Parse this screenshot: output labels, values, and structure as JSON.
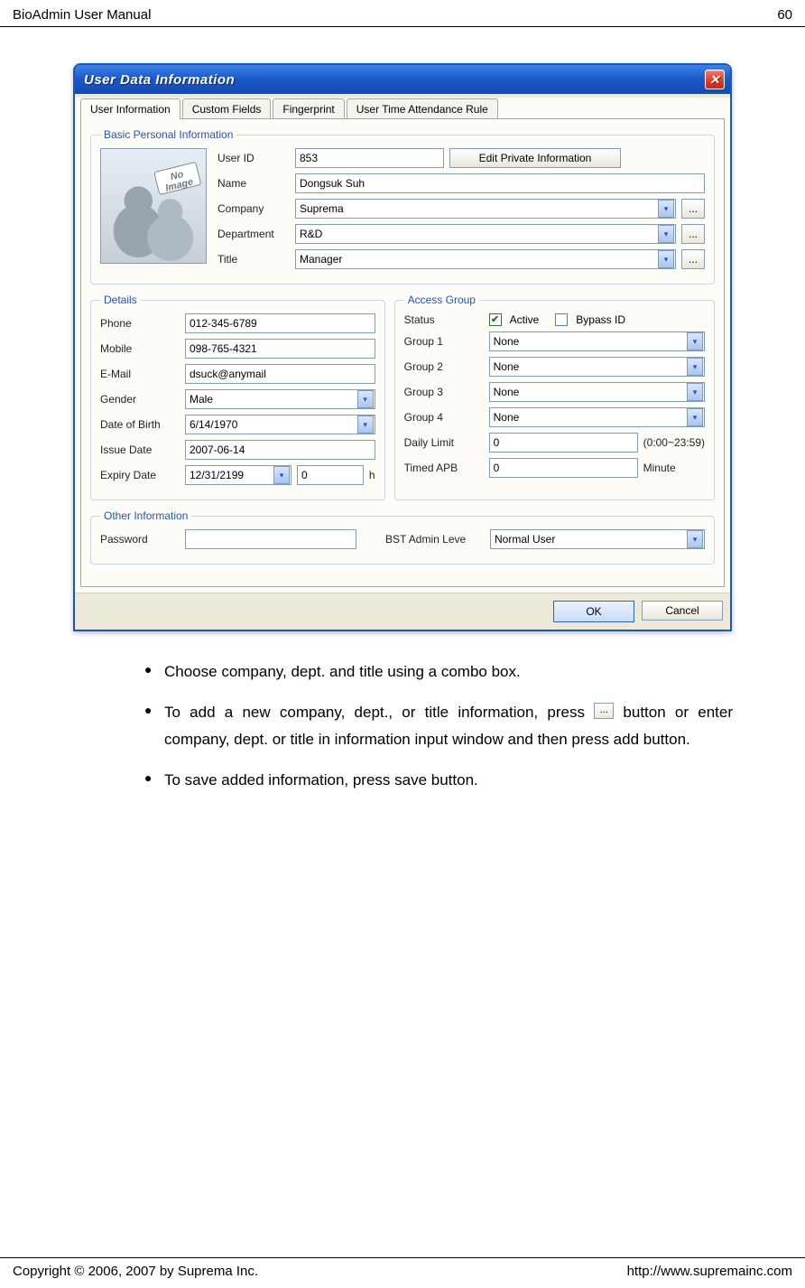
{
  "header": {
    "title": "BioAdmin User Manual",
    "page_no": "60"
  },
  "footer": {
    "copyright": "Copyright © 2006, 2007 by Suprema Inc.",
    "url": "http://www.supremainc.com"
  },
  "dialog": {
    "title": "User Data Information",
    "close_glyph": "✕",
    "tabs": [
      "User Information",
      "Custom Fields",
      "Fingerprint",
      "User Time Attendance Rule"
    ],
    "photo_placeholder": "No Image",
    "basic": {
      "legend": "Basic Personal Information",
      "labels": {
        "user_id": "User ID",
        "name": "Name",
        "company": "Company",
        "department": "Department",
        "title": "Title"
      },
      "values": {
        "user_id": "853",
        "name": "Dongsuk Suh",
        "company": "Suprema",
        "department": "R&D",
        "title": "Manager"
      },
      "edit_btn": "Edit Private Information",
      "ellipsis": "..."
    },
    "details": {
      "legend": "Details",
      "labels": {
        "phone": "Phone",
        "mobile": "Mobile",
        "email": "E-Mail",
        "gender": "Gender",
        "dob": "Date of Birth",
        "issue": "Issue Date",
        "expiry": "Expiry Date"
      },
      "values": {
        "phone": "012-345-6789",
        "mobile": "098-765-4321",
        "email": "dsuck@anymail",
        "gender": "Male",
        "dob": " 6/14/1970",
        "issue": "2007-06-14",
        "expiry": "12/31/2199",
        "expiry_num": "0",
        "expiry_unit": "h"
      }
    },
    "access": {
      "legend": "Access Group",
      "labels": {
        "status": "Status",
        "active": "Active",
        "bypass": "Bypass ID",
        "g1": "Group 1",
        "g2": "Group 2",
        "g3": "Group 3",
        "g4": "Group 4",
        "daily": "Daily Limit",
        "apb": "Timed APB"
      },
      "values": {
        "g1": "None",
        "g2": "None",
        "g3": "None",
        "g4": "None",
        "daily": "0",
        "daily_hint": "(0:00~23:59)",
        "apb": "0",
        "apb_unit": "Minute"
      },
      "check": "✔"
    },
    "other": {
      "legend": "Other Information",
      "labels": {
        "password": "Password",
        "level": "BST Admin Leve"
      },
      "values": {
        "password": "",
        "level": "Normal User"
      }
    },
    "buttons": {
      "ok": "OK",
      "cancel": "Cancel"
    },
    "arrow": "▾"
  },
  "bullets": {
    "b1": "Choose company, dept. and title using a combo box.",
    "b2a": "To add a new company, dept., or title information, press ",
    "b2_ellipsis": "...",
    "b2b": " button or enter company, dept. or title in information input window and then press add button.",
    "b3": " To save added information, press save button."
  }
}
